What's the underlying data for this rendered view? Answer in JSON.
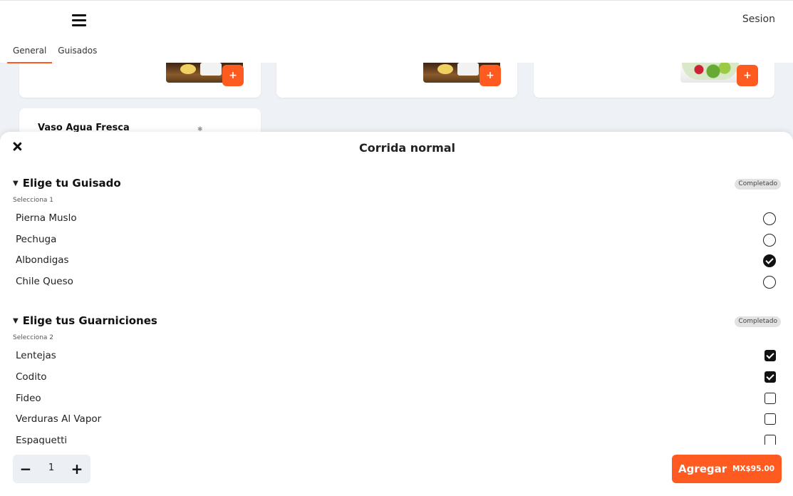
{
  "header": {
    "session_label": "Sesion",
    "tabs": [
      {
        "label": "General"
      },
      {
        "label": "Guisados"
      }
    ]
  },
  "background": {
    "card4_title": "Vaso Agua Fresca",
    "add_symbol": "+"
  },
  "modal": {
    "title": "Corrida normal",
    "groups": [
      {
        "title": "Elige tu Guisado",
        "badge": "Completado",
        "hint": "Selecciona 1",
        "options": [
          {
            "label": "Pierna Muslo",
            "selected": false
          },
          {
            "label": "Pechuga",
            "selected": false
          },
          {
            "label": "Albondigas",
            "selected": true
          },
          {
            "label": "Chile Queso",
            "selected": false
          }
        ]
      },
      {
        "title": "Elige tus Guarniciones",
        "badge": "Completado",
        "hint": "Selecciona 2",
        "options": [
          {
            "label": "Lentejas",
            "selected": true
          },
          {
            "label": "Codito",
            "selected": true
          },
          {
            "label": "Fideo",
            "selected": false
          },
          {
            "label": "Verduras Al Vapor",
            "selected": false
          },
          {
            "label": "Espaguetti",
            "selected": false
          }
        ]
      }
    ]
  },
  "footer": {
    "quantity": "1",
    "minus": "−",
    "plus": "+",
    "add_label": "Agregar",
    "price": "MX$95.00"
  },
  "colors": {
    "accent": "#ff5a1f"
  }
}
